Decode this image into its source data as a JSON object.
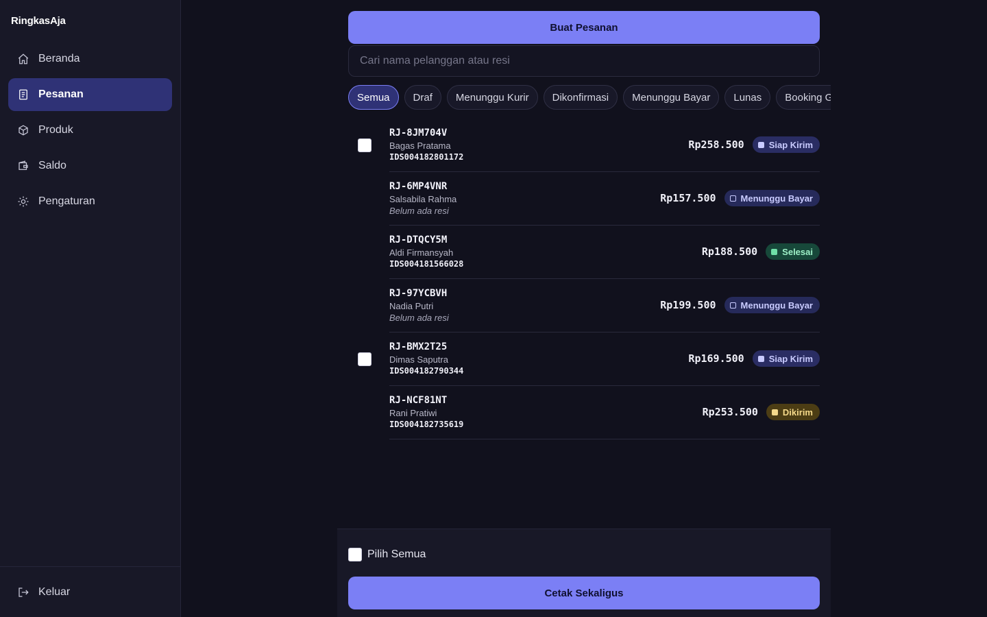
{
  "app": {
    "brand": "RingkasAja"
  },
  "sidebar": {
    "items": [
      {
        "label": "Beranda",
        "icon": "home-icon",
        "active": false
      },
      {
        "label": "Pesanan",
        "icon": "receipt-icon",
        "active": true
      },
      {
        "label": "Produk",
        "icon": "box-icon",
        "active": false
      },
      {
        "label": "Saldo",
        "icon": "wallet-icon",
        "active": false
      },
      {
        "label": "Pengaturan",
        "icon": "sun-icon",
        "active": false
      }
    ],
    "logout_label": "Keluar"
  },
  "main": {
    "create_button": "Buat Pesanan",
    "search_placeholder": "Cari nama pelanggan atau resi",
    "tabs": [
      {
        "label": "Semua",
        "active": true
      },
      {
        "label": "Draf"
      },
      {
        "label": "Menunggu Kurir"
      },
      {
        "label": "Dikonfirmasi"
      },
      {
        "label": "Menunggu Bayar"
      },
      {
        "label": "Lunas"
      },
      {
        "label": "Booking Gagal"
      }
    ],
    "orders": [
      {
        "id": "RJ-8JM704V",
        "name": "Bagas Pratama",
        "resi": "IDS004182801172",
        "price": "Rp258.500",
        "status": "Siap Kirim"
      },
      {
        "id": "RJ-6MP4VNR",
        "name": "Salsabila Rahma",
        "resi": "Belum ada resi",
        "price": "Rp157.500",
        "status": "Menunggu Bayar"
      },
      {
        "id": "RJ-DTQCY5M",
        "name": "Aldi Firmansyah",
        "resi": "IDS004181566028",
        "price": "Rp188.500",
        "status": "Selesai"
      },
      {
        "id": "RJ-97YCBVH",
        "name": "Nadia Putri",
        "resi": "Belum ada resi",
        "price": "Rp199.500",
        "status": "Menunggu Bayar"
      },
      {
        "id": "RJ-BMX2T25",
        "name": "Dimas Saputra",
        "resi": "IDS004182790344",
        "price": "Rp169.500",
        "status": "Siap Kirim"
      },
      {
        "id": "RJ-NCF81NT",
        "name": "Rani Pratiwi",
        "resi": "IDS004182735619",
        "price": "Rp253.500",
        "status": "Dikirim"
      }
    ],
    "select_all_label": "Pilih Semua",
    "print_button": "Cetak Sekaligus"
  },
  "colors": {
    "accent": "#7b7ff5",
    "active_nav": "#2f3276",
    "background": "#11111d",
    "sidebar": "#181827"
  }
}
